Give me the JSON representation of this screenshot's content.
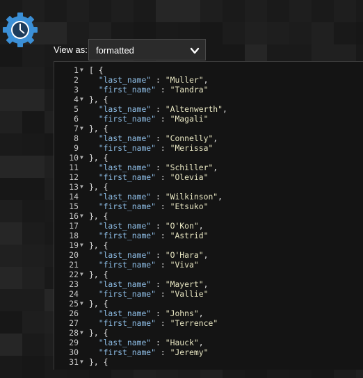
{
  "header": {
    "view_as_label": "View as:",
    "view_mode_value": "formatted"
  },
  "icons": {
    "logo": "gear-clock-icon",
    "dropdown": "chevron-down-icon",
    "fold": "fold-triangle-icon"
  },
  "colors": {
    "accent": "#3b8fd6",
    "key": "#8fbfe8",
    "string": "#e8e6c2"
  },
  "editor": {
    "lines": [
      {
        "n": "1",
        "fold": true,
        "open": "[ {"
      },
      {
        "n": "2",
        "key": "\"last_name\"",
        "sep": " : ",
        "val": "\"Muller\"",
        "end": ","
      },
      {
        "n": "3",
        "key": "\"first_name\"",
        "sep": " : ",
        "val": "\"Tandra\"",
        "end": ""
      },
      {
        "n": "4",
        "fold": true,
        "open": "}, {"
      },
      {
        "n": "5",
        "key": "\"last_name\"",
        "sep": " : ",
        "val": "\"Altenwerth\"",
        "end": ","
      },
      {
        "n": "6",
        "key": "\"first_name\"",
        "sep": " : ",
        "val": "\"Magali\"",
        "end": ""
      },
      {
        "n": "7",
        "fold": true,
        "open": "}, {"
      },
      {
        "n": "8",
        "key": "\"last_name\"",
        "sep": " : ",
        "val": "\"Connelly\"",
        "end": ","
      },
      {
        "n": "9",
        "key": "\"first_name\"",
        "sep": " : ",
        "val": "\"Merissa\"",
        "end": ""
      },
      {
        "n": "10",
        "fold": true,
        "open": "}, {"
      },
      {
        "n": "11",
        "key": "\"last_name\"",
        "sep": " : ",
        "val": "\"Schiller\"",
        "end": ","
      },
      {
        "n": "12",
        "key": "\"first_name\"",
        "sep": " : ",
        "val": "\"Olevia\"",
        "end": ""
      },
      {
        "n": "13",
        "fold": true,
        "open": "}, {"
      },
      {
        "n": "14",
        "key": "\"last_name\"",
        "sep": " : ",
        "val": "\"Wilkinson\"",
        "end": ","
      },
      {
        "n": "15",
        "key": "\"first_name\"",
        "sep": " : ",
        "val": "\"Etsuko\"",
        "end": ""
      },
      {
        "n": "16",
        "fold": true,
        "open": "}, {"
      },
      {
        "n": "17",
        "key": "\"last_name\"",
        "sep": " : ",
        "val": "\"O'Kon\"",
        "end": ","
      },
      {
        "n": "18",
        "key": "\"first_name\"",
        "sep": " : ",
        "val": "\"Astrid\"",
        "end": ""
      },
      {
        "n": "19",
        "fold": true,
        "open": "}, {"
      },
      {
        "n": "20",
        "key": "\"last_name\"",
        "sep": " : ",
        "val": "\"O'Hara\"",
        "end": ","
      },
      {
        "n": "21",
        "key": "\"first_name\"",
        "sep": " : ",
        "val": "\"Viva\"",
        "end": ""
      },
      {
        "n": "22",
        "fold": true,
        "open": "}, {"
      },
      {
        "n": "23",
        "key": "\"last_name\"",
        "sep": " : ",
        "val": "\"Mayert\"",
        "end": ","
      },
      {
        "n": "24",
        "key": "\"first_name\"",
        "sep": " : ",
        "val": "\"Vallie\"",
        "end": ""
      },
      {
        "n": "25",
        "fold": true,
        "open": "}, {"
      },
      {
        "n": "26",
        "key": "\"last_name\"",
        "sep": " : ",
        "val": "\"Johns\"",
        "end": ","
      },
      {
        "n": "27",
        "key": "\"first_name\"",
        "sep": " : ",
        "val": "\"Terrence\"",
        "end": ""
      },
      {
        "n": "28",
        "fold": true,
        "open": "}, {"
      },
      {
        "n": "29",
        "key": "\"last_name\"",
        "sep": " : ",
        "val": "\"Hauck\"",
        "end": ","
      },
      {
        "n": "30",
        "key": "\"first_name\"",
        "sep": " : ",
        "val": "\"Jeremy\"",
        "end": ""
      },
      {
        "n": "31",
        "fold": true,
        "open": "}, {"
      }
    ]
  }
}
